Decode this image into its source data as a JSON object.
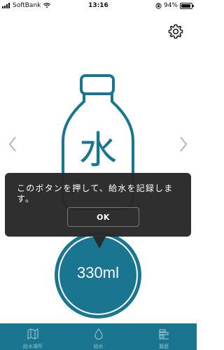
{
  "status_bar": {
    "carrier": "SoftBank",
    "time": "13:16",
    "battery_percent": "94%",
    "battery_level": 0.94
  },
  "bottle": {
    "label": "水"
  },
  "dialog": {
    "message": "このボタンを押して、給水を記録します。",
    "ok_label": "OK"
  },
  "record_button": {
    "amount": "330ml"
  },
  "tab_bar": {
    "tabs": [
      {
        "label": "給水場所",
        "icon": "map-icon"
      },
      {
        "label": "給水",
        "icon": "water-drop-icon"
      },
      {
        "label": "履歴",
        "icon": "history-icon"
      }
    ]
  },
  "colors": {
    "brand": "#1a7590",
    "dialog_bg": "#282828"
  }
}
